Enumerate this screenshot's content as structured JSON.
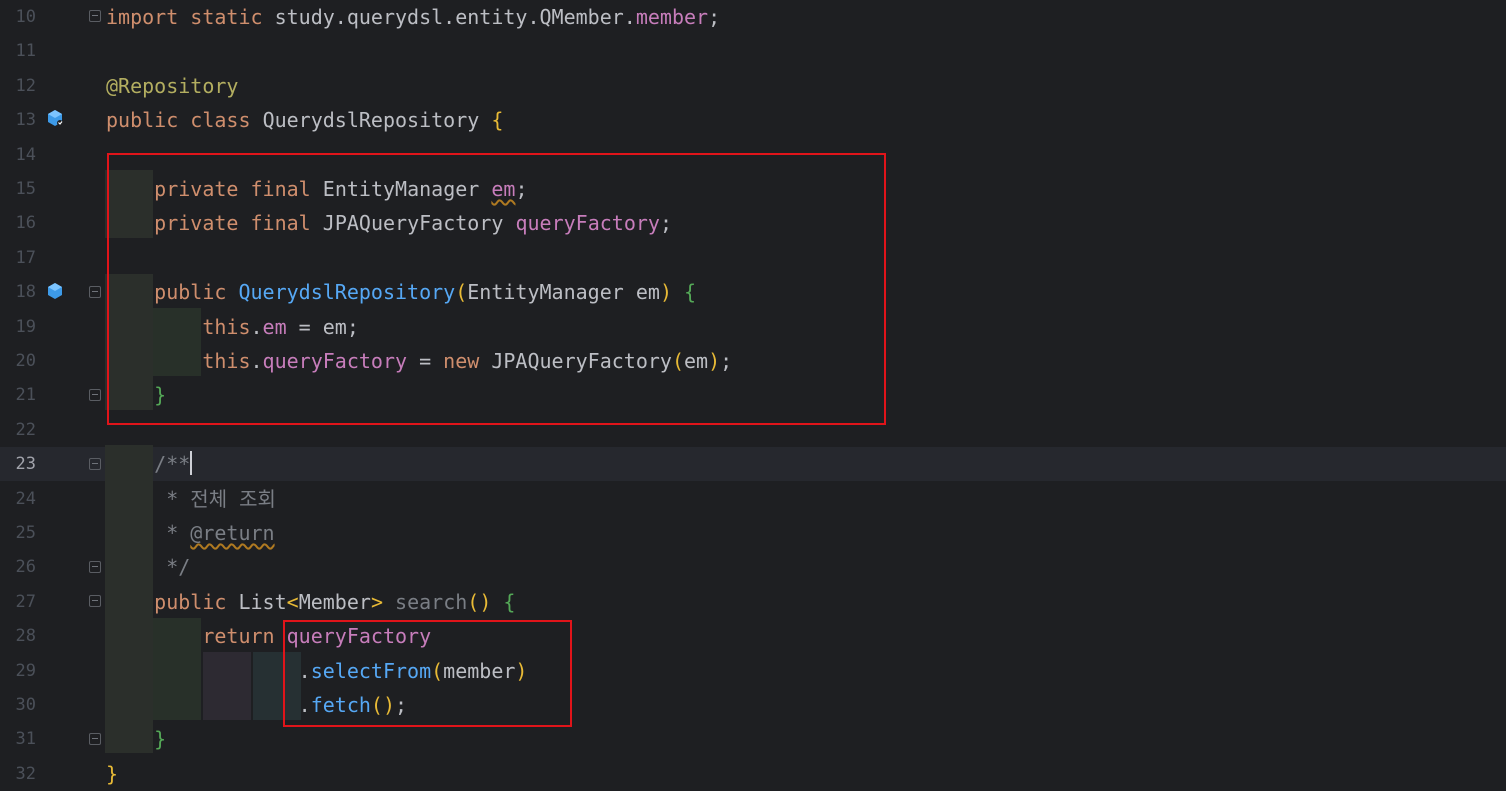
{
  "editor": {
    "theme_colors": {
      "background": "#1e1f22",
      "keyword": "#cf8e6d",
      "annotation": "#b3ae60",
      "field": "#c77dbb",
      "method": "#56a8f5",
      "comment": "#7a7e85",
      "highlight_box": "#e0141a"
    },
    "current_line": 23,
    "lines": [
      {
        "n": "10",
        "text": "import static study.querydsl.entity.QMember.member;"
      },
      {
        "n": "11",
        "text": ""
      },
      {
        "n": "12",
        "text": "@Repository"
      },
      {
        "n": "13",
        "text": "public class QuerydslRepository {"
      },
      {
        "n": "14",
        "text": ""
      },
      {
        "n": "15",
        "text": "    private final EntityManager em;"
      },
      {
        "n": "16",
        "text": "    private final JPAQueryFactory queryFactory;"
      },
      {
        "n": "17",
        "text": ""
      },
      {
        "n": "18",
        "text": "    public QuerydslRepository(EntityManager em) {"
      },
      {
        "n": "19",
        "text": "        this.em = em;"
      },
      {
        "n": "20",
        "text": "        this.queryFactory = new JPAQueryFactory(em);"
      },
      {
        "n": "21",
        "text": "    }"
      },
      {
        "n": "22",
        "text": ""
      },
      {
        "n": "23",
        "text": "    /**"
      },
      {
        "n": "24",
        "text": "     * 전체 조회"
      },
      {
        "n": "25",
        "text": "     * @return"
      },
      {
        "n": "26",
        "text": "     */"
      },
      {
        "n": "27",
        "text": "    public List<Member> search() {"
      },
      {
        "n": "28",
        "text": "        return queryFactory"
      },
      {
        "n": "29",
        "text": "                .selectFrom(member)"
      },
      {
        "n": "30",
        "text": "                .fetch();"
      },
      {
        "n": "31",
        "text": "    }"
      },
      {
        "n": "32",
        "text": "}"
      }
    ],
    "tokens": {
      "import_kw": "import",
      "static_kw": "static",
      "import_path": " study.querydsl.entity.QMember.",
      "import_member": "member",
      "semicolon": ";",
      "annotation": "@Repository",
      "public_kw": "public",
      "class_kw": "class",
      "class_name": "QuerydslRepository",
      "open_brace": "{",
      "close_brace": "}",
      "private_kw": "private",
      "final_kw": "final",
      "entity_manager": "EntityManager",
      "em": "em",
      "jpa_query_factory": "JPAQueryFactory",
      "query_factory": "queryFactory",
      "ctor_name": "QuerydslRepository",
      "lparen": "(",
      "rparen": ")",
      "this_kw": "this",
      "dot": ".",
      "assign": " = ",
      "new_kw": "new",
      "doc_open": "/**",
      "doc_line1": " * 전체 조회",
      "doc_star": " * ",
      "doc_return": "@return",
      "doc_close": " */",
      "list_type": "List",
      "lt": "<",
      "member_type": "Member",
      "gt": ">",
      "search_name": "search",
      "empty_parens": "()",
      "return_kw": "return",
      "select_from": "selectFrom",
      "member_arg": "member",
      "fetch": "fetch"
    }
  }
}
